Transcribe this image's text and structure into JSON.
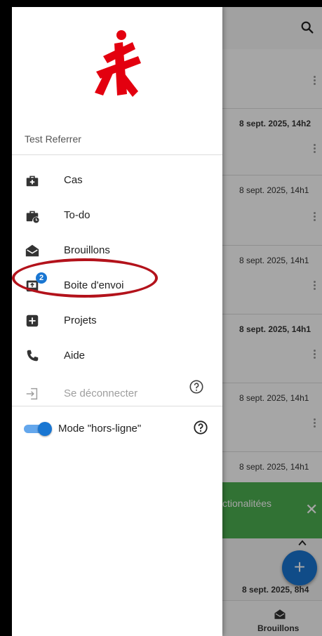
{
  "background": {
    "cards": [
      {
        "date": "",
        "bold": false
      },
      {
        "date": "8 sept. 2025, 14h2",
        "bold": true
      },
      {
        "date": "8 sept. 2025, 14h1",
        "bold": false
      },
      {
        "date": "8 sept. 2025, 14h1",
        "bold": false
      },
      {
        "date": "8 sept. 2025, 14h1",
        "bold": true
      },
      {
        "date": "8 sept. 2025, 14h1",
        "bold": false
      },
      {
        "date": "8 sept. 2025, 14h1",
        "bold": false
      }
    ],
    "last_date": "8 sept. 2025, 8h4",
    "snackbar_text": "ctionalitées",
    "snackbar_close": "✕",
    "fab_label": "+",
    "bottom_nav_label": "Brouillons"
  },
  "drawer": {
    "user_name": "Test Referrer",
    "items": [
      {
        "label": "Cas",
        "icon": "medkit-icon"
      },
      {
        "label": "To-do",
        "icon": "briefcase-clock-icon"
      },
      {
        "label": "Brouillons",
        "icon": "envelope-open-icon"
      },
      {
        "label": "Boite d'envoi",
        "icon": "outbox-icon",
        "badge": "2"
      },
      {
        "label": "Projets",
        "icon": "plus-square-icon"
      },
      {
        "label": "Aide",
        "icon": "phone-icon"
      },
      {
        "label": "Se déconnecter",
        "icon": "logout-icon",
        "disabled": true
      }
    ],
    "offline_mode": {
      "label": "Mode \"hors-ligne\"",
      "enabled": true
    }
  },
  "colors": {
    "brand_red": "#e3000f",
    "accent_blue": "#1976d2",
    "annotation_red": "#b3121b",
    "snackbar_green": "#4caf50"
  }
}
